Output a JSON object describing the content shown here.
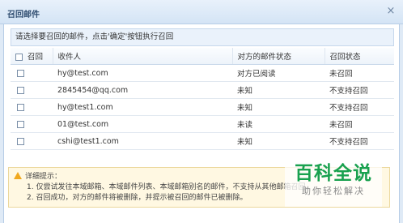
{
  "dialog": {
    "title": "召回邮件",
    "close_symbol": "×",
    "instruction": "请选择要召回的邮件，点击'确定'按钮执行召回"
  },
  "table": {
    "headers": [
      "召回",
      "收件人",
      "对方的邮件状态",
      "召回状态"
    ],
    "rows": [
      {
        "recipient": "hy@test.com",
        "mail_status": "对方已阅读",
        "recall_status": "未召回"
      },
      {
        "recipient": "2845454@qq.com",
        "mail_status": "未知",
        "recall_status": "不支持召回"
      },
      {
        "recipient": "hy@test1.com",
        "mail_status": "未知",
        "recall_status": "不支持召回"
      },
      {
        "recipient": "01@test.com",
        "mail_status": "未读",
        "recall_status": "未召回"
      },
      {
        "recipient": "cshi@test1.com",
        "mail_status": "未知",
        "recall_status": "不支持召回"
      }
    ]
  },
  "tips": {
    "heading": "详细提示：",
    "lines": [
      "1. 仅尝试发往本域邮箱、本域邮件列表、本域邮箱别名的邮件，不支持从其他邮箱召回。",
      "2. 召回成功，对方的邮件将被删除，并提示被召回的邮件已被删除。"
    ]
  },
  "watermark": {
    "title": "百科全说",
    "subtitle": "助你轻松解决"
  },
  "colors": {
    "accent": "#2f4d70",
    "watermark_green": "#19a14f",
    "tip_background": "#fff8e2"
  }
}
